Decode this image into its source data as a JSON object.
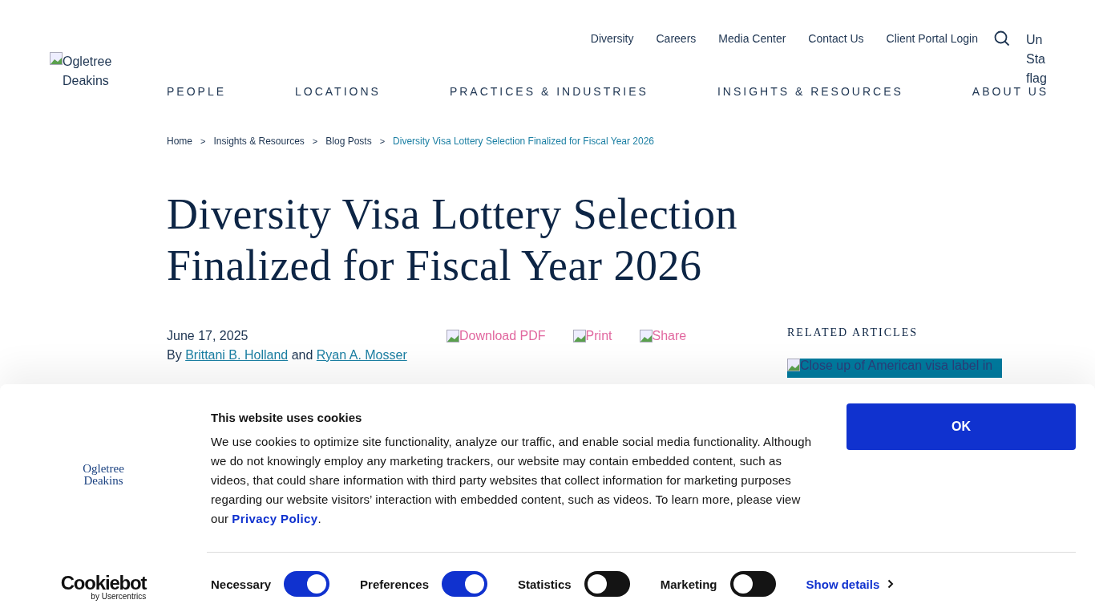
{
  "header": {
    "logo_alt": "Ogletree Deakins",
    "top_links": [
      "Diversity",
      "Careers",
      "Media Center",
      "Contact Us",
      "Client Portal Login"
    ],
    "flag_alt": "Un Sta flag",
    "nav": [
      "PEOPLE",
      "LOCATIONS",
      "PRACTICES & INDUSTRIES",
      "INSIGHTS & RESOURCES",
      "ABOUT US"
    ]
  },
  "breadcrumb": [
    {
      "label": "Home",
      "selected": false
    },
    {
      "label": "Insights & Resources",
      "selected": false
    },
    {
      "label": "Blog Posts",
      "selected": false
    },
    {
      "label": "Diversity Visa Lottery Selection Finalized for Fiscal Year 2026",
      "selected": true
    }
  ],
  "breadcrumb_separator": ">",
  "article": {
    "title": "Diversity Visa Lottery Selection Finalized for Fiscal Year 2026",
    "date": "June 17, 2025",
    "by": "By",
    "authors": [
      "Brittani B. Holland",
      "Ryan A. Mosser"
    ],
    "and": "and",
    "actions": [
      "Download PDF",
      "Print",
      "Share"
    ]
  },
  "related": {
    "heading": "RELATED ARTICLES",
    "image_alt": "Close up of American visa label in"
  },
  "cookie_banner": {
    "logo": [
      "Ogletree",
      "Deakins"
    ],
    "brand": "Cookiebot",
    "brand_sub": "by Usercentrics",
    "title": "This website uses cookies",
    "text": "We use cookies to optimize site functionality, analyze our traffic, and enable social media functionality. Although we do not knowingly employ any marketing trackers, our website may contain embedded content, such as videos, that could share information with third party websites that collect information for marketing purposes regarding our website visitors’ interaction with embedded content, such as videos. To learn more, please view our",
    "link": "Privacy Policy",
    "after_link": ".",
    "ok": "OK",
    "toggles": [
      {
        "label": "Necessary",
        "on": true
      },
      {
        "label": "Preferences",
        "on": true
      },
      {
        "label": "Statistics",
        "on": false
      },
      {
        "label": "Marketing",
        "on": false
      }
    ],
    "show_details": "Show details"
  }
}
